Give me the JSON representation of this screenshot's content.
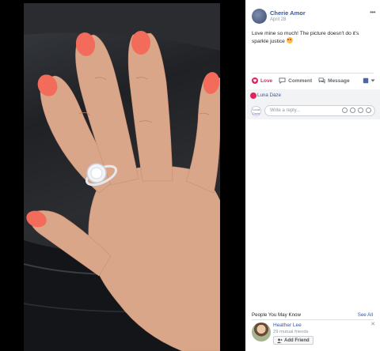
{
  "post": {
    "author": "Cherie Amor",
    "date": "April 28",
    "text": "Love mine so much! The picture doesn't do it's sparkle justice",
    "menu_icon": "more-icon"
  },
  "actions": {
    "love_label": "Love",
    "comment_label": "Comment",
    "message_label": "Message"
  },
  "reactions": {
    "reactor_name": "Luna Daze"
  },
  "comment_box": {
    "placeholder": "Write a reply...",
    "avatar_text": "Luna Daze"
  },
  "pymk": {
    "title": "People You May Know",
    "see_all": "See All",
    "person": {
      "name": "Heather Lee",
      "mutual": "29 mutual friends",
      "add_label": "Add Friend"
    }
  },
  "colors": {
    "link_blue": "#365899",
    "love_red": "#e0245e",
    "nail_coral": "#f36b5a"
  }
}
